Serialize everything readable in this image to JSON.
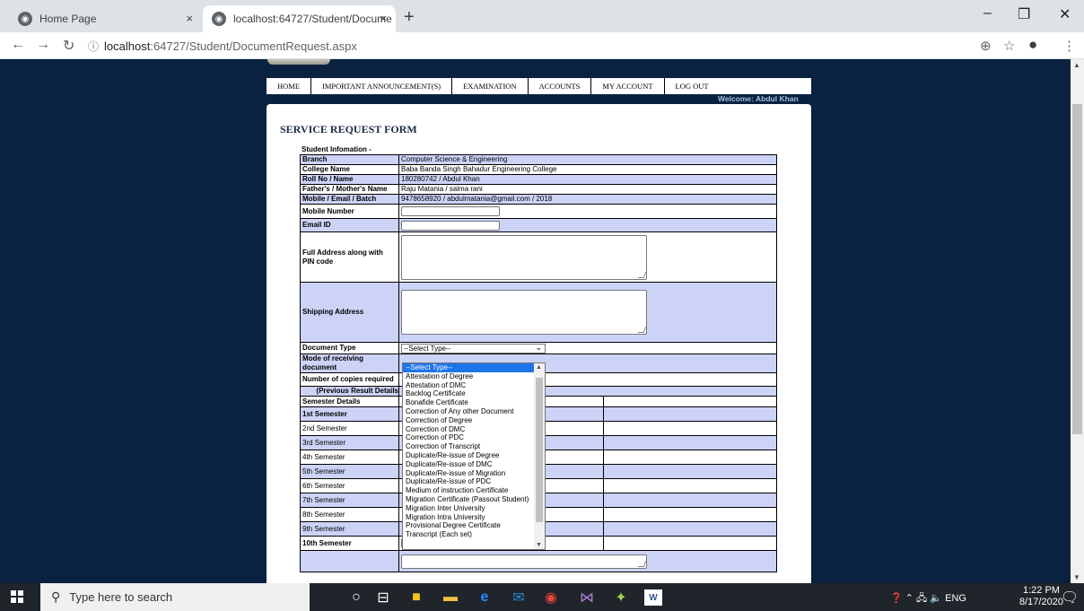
{
  "browser": {
    "tabs": [
      {
        "title": "Home Page",
        "close": "×"
      },
      {
        "title": "localhost:64727/Student/Docume",
        "close": "×"
      }
    ],
    "new_tab": "+",
    "url_host": "localhost",
    "url_rest": ":64727/Student/DocumentRequest.aspx"
  },
  "menu": [
    "HOME",
    "IMPORTANT ANNOUNCEMENT(S)",
    "EXAMINATION",
    "ACCOUNTS",
    "MY ACCOUNT",
    "LOG OUT"
  ],
  "welcome": "Welcome: Abdul Khan",
  "form": {
    "title": "SERVICE REQUEST FORM",
    "section_caption": "Student Infomation -",
    "rows": [
      {
        "label": "Branch",
        "value": "Computer Science & Engineering"
      },
      {
        "label": "College Name",
        "value": "Baba Banda Singh Bahadur Engineering College"
      },
      {
        "label": "Roll No / Name",
        "value": "180280742 / Abdul Khan"
      },
      {
        "label": "Father's / Mother's Name",
        "value": "Raju Matania / salma rani"
      },
      {
        "label": "Mobile / Email / Batch",
        "value": "9478658920 / abdulmatania@gmail.com / 2018"
      }
    ],
    "mobile_label": "Mobile Number",
    "email_label": "Email ID",
    "address_label": "Full Address along with PIN code",
    "shipping_label": "Shipping Address",
    "doc_type_label": "Document Type",
    "doc_type_value": "--Select Type--",
    "mode_label": "Mode of receiving document",
    "copies_label": "Number of copies required",
    "prev_results": "(Previous Result Details",
    "semester_header": "Semester Details",
    "semesters": [
      "1st Semester",
      "2nd Semester",
      "3rd Semester",
      "4th Semester",
      "5th Semester",
      "6th Semester",
      "7th Semester",
      "8th Semester",
      "9th Semester",
      "10th Semester"
    ]
  },
  "dropdown_options": [
    "--Select Type--",
    "Attestation of Degree",
    "Attestation of DMC",
    "Backlog Certificate",
    "Bonafide Certificate",
    "Correction of Any other Document",
    "Correction of Degree",
    "Correction of DMC",
    "Correction of PDC",
    "Correction of Transcript",
    "Duplicate/Re-issue of Degree",
    "Duplicate/Re-issue of DMC",
    "Duplicate/Re-issue of Migration",
    "Duplicate/Re-issue of PDC",
    "Medium of instruction Certificate",
    "Migration Certificate (Passout Student)",
    "Migration Inter University",
    "Migration Intra University",
    "Provisional Degree Certificate",
    "Transcript (Each set)"
  ],
  "taskbar": {
    "search_placeholder": "Type here to search",
    "lang": "ENG",
    "time": "1:22 PM",
    "date": "8/17/2020"
  },
  "colors": {
    "page_bg": "#0a2140",
    "row_alt": "#cdd3f7",
    "selected": "#1e74e9"
  }
}
